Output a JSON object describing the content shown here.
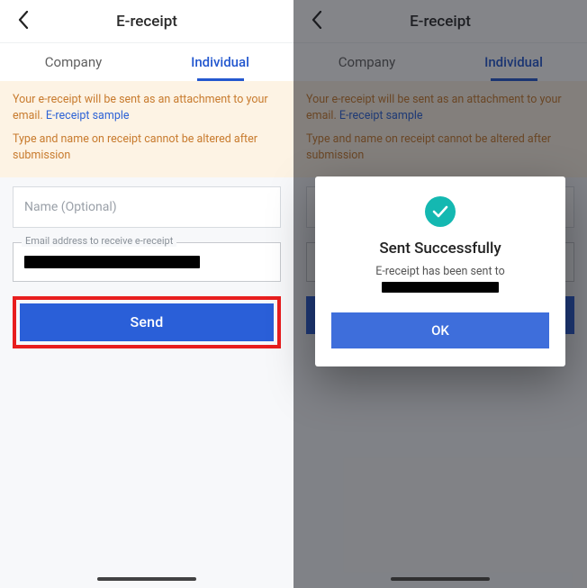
{
  "header": {
    "title": "E-receipt"
  },
  "tabs": {
    "company": "Company",
    "individual": "Individual"
  },
  "notice": {
    "line1a": "Your e-receipt will be sent as an attachment to your email. ",
    "sample_link": "E-receipt sample",
    "line2": "Type and name on receipt cannot be altered after submission"
  },
  "form": {
    "name_placeholder": "Name (Optional)",
    "email_label": "Email address to receive e-receipt",
    "send_label": "Send"
  },
  "modal": {
    "title": "Sent Successfully",
    "message": "E-receipt has been sent to",
    "ok_label": "OK"
  }
}
